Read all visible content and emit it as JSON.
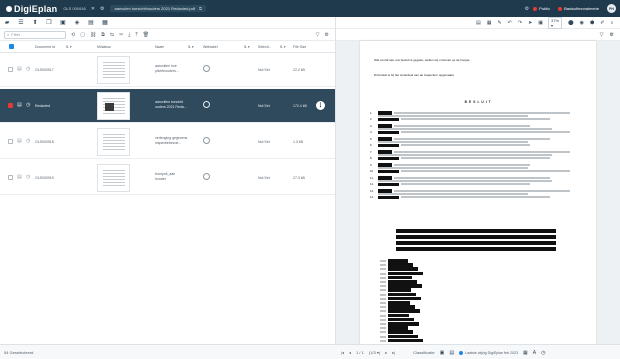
{
  "app": {
    "brand": "DigiEplan",
    "meta": "OLS 000916",
    "doc_tab": "aanvulen toezichthouders 2021 Redacted.pdf",
    "status_label": "Public",
    "user_label": "Basisufimonalmerie",
    "user_initials": "PH",
    "colors": {
      "titlebar": "#1f3a4d",
      "selected_row": "#2f4a5d",
      "accent_blue": "#1e88e5",
      "status_red": "#e53935"
    }
  },
  "filter": {
    "placeholder": "Filter"
  },
  "columns": [
    "Document Id",
    "Miniatuur",
    "Naam",
    "Weblabel",
    "Selecti...",
    "File Size"
  ],
  "rows": [
    {
      "id": "OLS000917",
      "name_line1": "aanvullen hoe",
      "name_line2": "plichthouders...",
      "state": "Not Set",
      "size": "22.2 kB",
      "selected": false
    },
    {
      "id": "Redacted",
      "name_line1": "aanvullen toezicht",
      "name_line2": "ouders 2021 Reda...",
      "state": "Not Set",
      "size": "172.4 kB",
      "selected": true
    },
    {
      "id": "OLS000918",
      "name_line1": "verlenging gegevens",
      "name_line2": "inspectiebezoe...",
      "state": "Not Set",
      "size": "1.3 kB",
      "selected": false
    },
    {
      "id": "OLS000919",
      "name_line1": "trompoll_aan",
      "name_line2": "houder",
      "state": "Not Set",
      "size": "27.3 kB",
      "selected": false
    }
  ],
  "viewer": {
    "zoom": "37% ▾",
    "heading": "B E S L U I T",
    "intro1": "Wat vooraf aan ons besluit is gegaan, stellen wij u hiervan op de hoogte.",
    "intro2": "Dit besluit is bij het onderdeel van de Inspecteur opgemaakt."
  },
  "footer": {
    "count": "54 Geselecteerd",
    "pages": "1 / 1",
    "page_info": "(1/3 ▾)",
    "classification": "Classificatie",
    "note": "Laatste wijzig DigiEplan feb 2023"
  }
}
